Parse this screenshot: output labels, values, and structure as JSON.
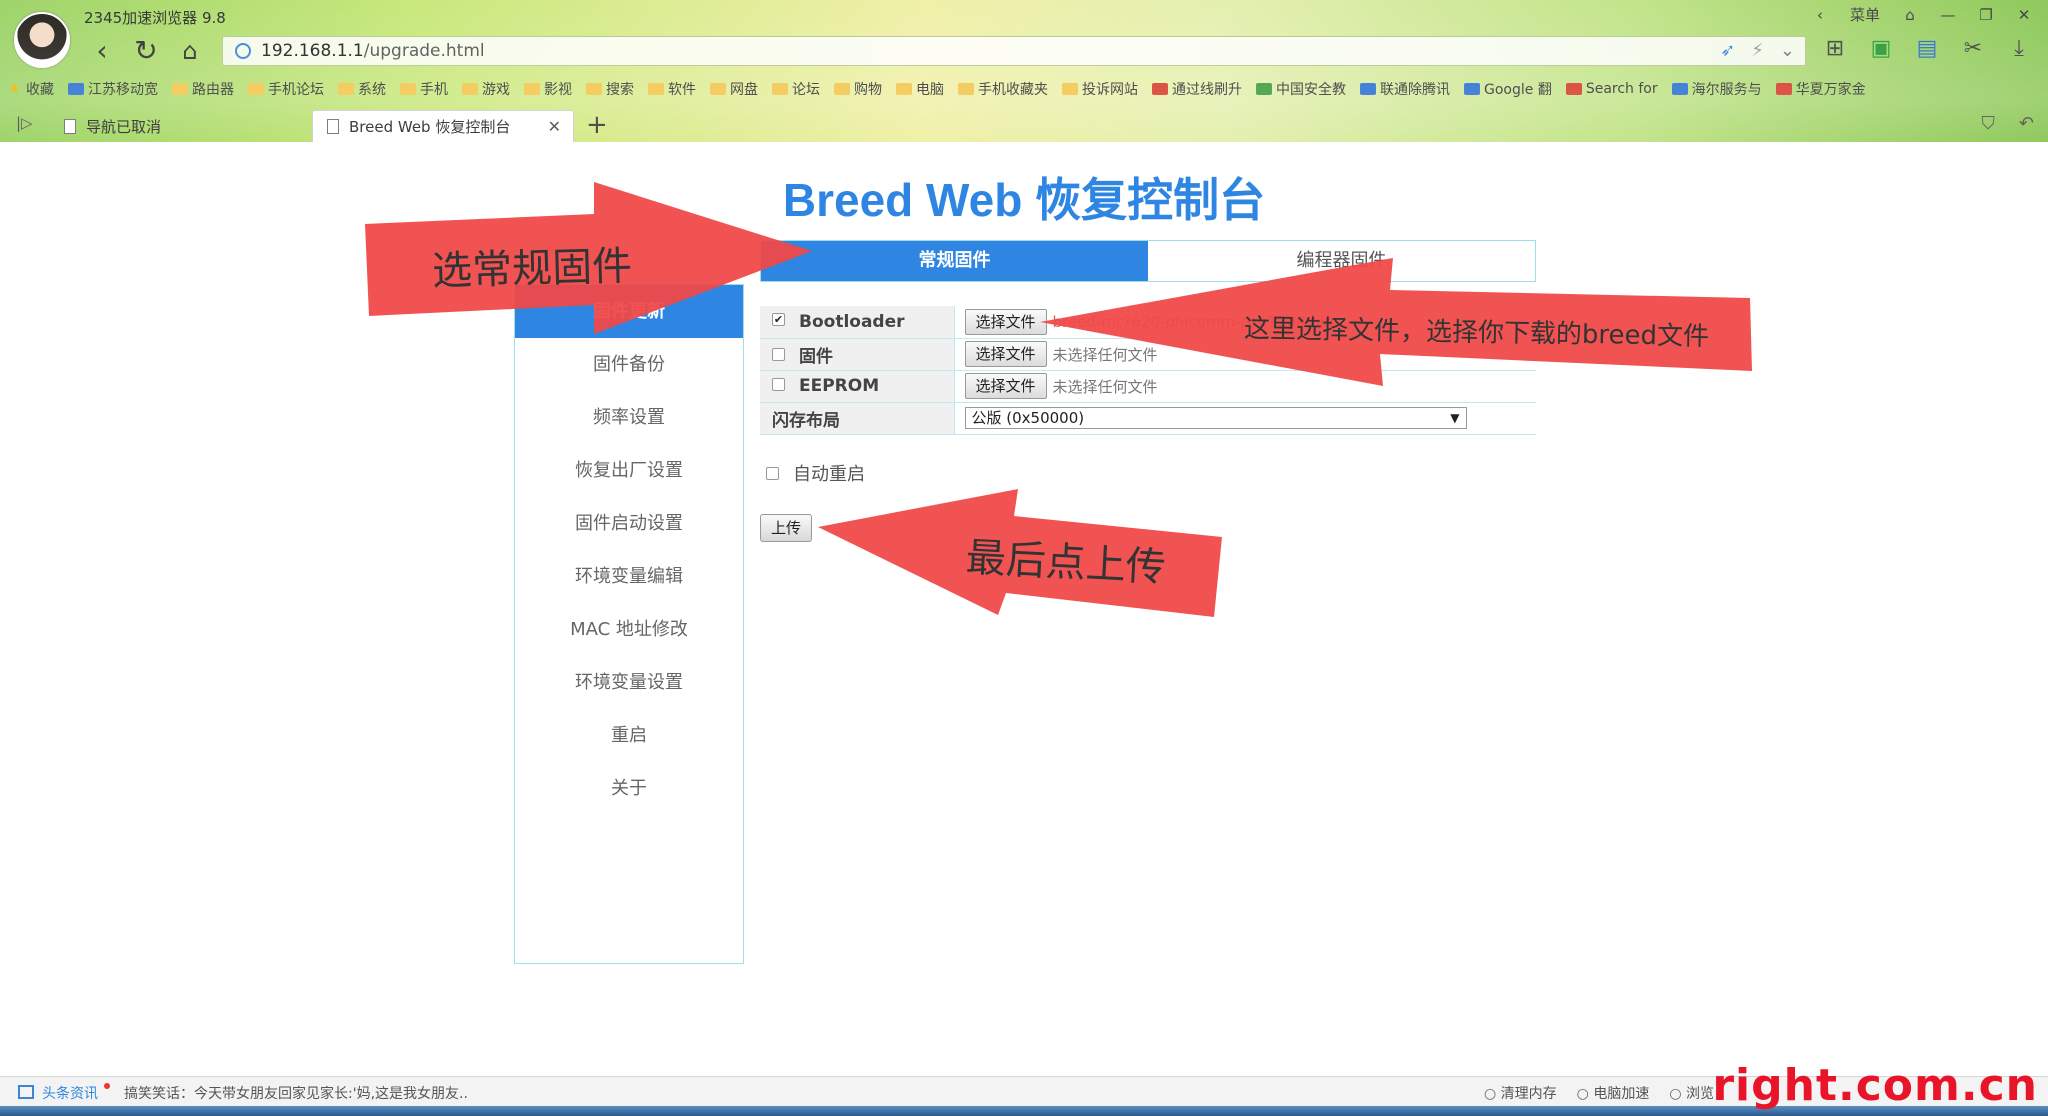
{
  "browser": {
    "app_title": "2345加速浏览器 9.8",
    "window_controls": [
      "‹",
      "菜单",
      "⌂",
      "—",
      "❐",
      "✕"
    ],
    "url_host": "192.168.1.1",
    "url_path": "/upgrade.html",
    "bookmarks": [
      "收藏",
      "江苏移动宽",
      "路由器",
      "手机论坛",
      "系统",
      "手机",
      "游戏",
      "影视",
      "搜索",
      "软件",
      "网盘",
      "论坛",
      "购物",
      "电脑",
      "手机收藏夹",
      "投诉网站",
      "通过线刷升",
      "中国安全教",
      "联通除腾讯",
      "Google 翻",
      "Search for",
      "海尔服务与",
      "华夏万家金"
    ],
    "tabs": [
      {
        "label": "导航已取消"
      },
      {
        "label": "Breed Web 恢复控制台"
      }
    ],
    "new_tab": "+"
  },
  "page": {
    "title": "Breed Web 恢复控制台",
    "sidebar": [
      {
        "label": "固件更新"
      },
      {
        "label": "固件备份"
      },
      {
        "label": "频率设置"
      },
      {
        "label": "恢复出厂设置"
      },
      {
        "label": "固件启动设置"
      },
      {
        "label": "环境变量编辑"
      },
      {
        "label": "MAC 地址修改"
      },
      {
        "label": "环境变量设置"
      },
      {
        "label": "重启"
      },
      {
        "label": "关于"
      }
    ],
    "firmware_tabs": [
      {
        "label": "常规固件"
      },
      {
        "label": "编程器固件"
      }
    ],
    "rows": [
      {
        "label": "Bootloader",
        "checked": true,
        "button": "选择文件",
        "status": "breed-mt7620-phicomm-psg1208.bin"
      },
      {
        "label": "固件",
        "checked": false,
        "button": "选择文件",
        "status": "未选择任何文件"
      },
      {
        "label": "EEPROM",
        "checked": false,
        "button": "选择文件",
        "status": "未选择任何文件"
      }
    ],
    "flash_layout": {
      "label": "闪存布局",
      "value": "公版 (0x50000)"
    },
    "auto_reboot": {
      "label": "自动重启",
      "checked": false
    },
    "upload_button": "上传"
  },
  "annotations": {
    "a1": "选常规固件",
    "a2": "这里选择文件，选择你下载的breed文件",
    "a3": "最后点上传",
    "color": "#f04848"
  },
  "statusbar": {
    "news_label": "头条资讯",
    "news_text": "搞笑笑话：今天带女朋友回家见家长:'妈,这是我女朋友..",
    "right_items": [
      "清理内存",
      "电脑加速",
      "浏览"
    ]
  },
  "watermark": "right.com.cn",
  "colors": {
    "accent": "#2f86e2",
    "border": "#9de0e8"
  }
}
